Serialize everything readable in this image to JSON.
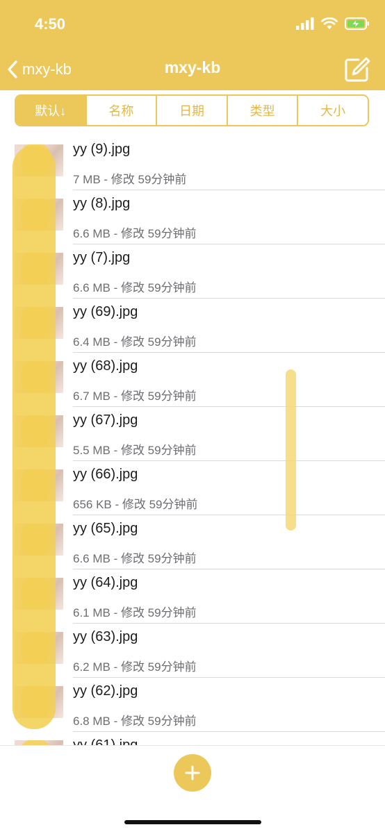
{
  "status_bar": {
    "time": "4:50"
  },
  "nav": {
    "back_label": "mxy-kb",
    "title": "mxy-kb"
  },
  "sort_tabs": [
    {
      "label": "默认↓",
      "active": true
    },
    {
      "label": "名称",
      "active": false
    },
    {
      "label": "日期",
      "active": false
    },
    {
      "label": "类型",
      "active": false
    },
    {
      "label": "大小",
      "active": false
    }
  ],
  "files": [
    {
      "name": "yy (9).jpg",
      "meta": "7 MB - 修改 59分钟前"
    },
    {
      "name": "yy (8).jpg",
      "meta": "6.6 MB - 修改 59分钟前"
    },
    {
      "name": "yy (7).jpg",
      "meta": "6.6 MB - 修改 59分钟前"
    },
    {
      "name": "yy (69).jpg",
      "meta": "6.4 MB - 修改 59分钟前"
    },
    {
      "name": "yy (68).jpg",
      "meta": "6.7 MB - 修改 59分钟前"
    },
    {
      "name": "yy (67).jpg",
      "meta": "5.5 MB - 修改 59分钟前"
    },
    {
      "name": "yy (66).jpg",
      "meta": "656 KB - 修改 59分钟前"
    },
    {
      "name": "yy (65).jpg",
      "meta": "6.6 MB - 修改 59分钟前"
    },
    {
      "name": "yy (64).jpg",
      "meta": "6.1 MB - 修改 59分钟前"
    },
    {
      "name": "yy (63).jpg",
      "meta": "6.2 MB - 修改 59分钟前"
    },
    {
      "name": "yy (62).jpg",
      "meta": "6.8 MB - 修改 59分钟前"
    },
    {
      "name": "yy (61).jpg",
      "meta": ""
    }
  ],
  "icons": {
    "back": "chevron-left-icon",
    "edit": "compose-icon",
    "add": "plus-icon",
    "signal": "cellular-signal-icon",
    "wifi": "wifi-icon",
    "battery": "battery-charging-icon"
  },
  "colors": {
    "accent": "#ecc75a",
    "text": "#1c1c1e",
    "secondary_text": "#6d6d72"
  }
}
